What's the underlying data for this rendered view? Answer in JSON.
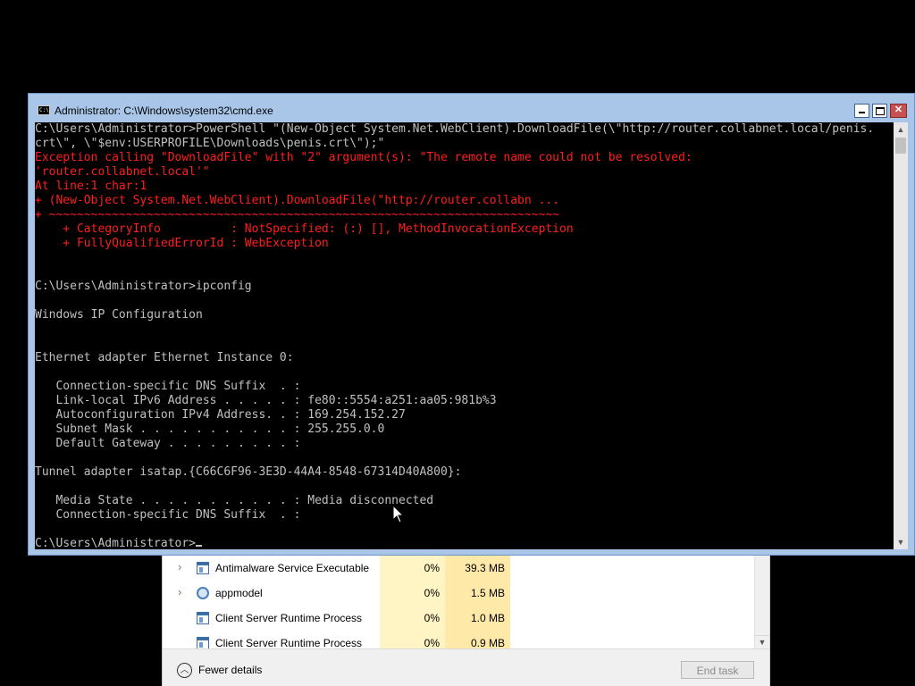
{
  "taskmgr": {
    "processes": [
      {
        "name": "Antimalware Service Executable",
        "cpu": "0%",
        "memory": "39.3 MB",
        "expandable": true,
        "icon": "window-icon"
      },
      {
        "name": "appmodel",
        "cpu": "0%",
        "memory": "1.5 MB",
        "expandable": true,
        "icon": "gear-icon"
      },
      {
        "name": "Client Server Runtime Process",
        "cpu": "0%",
        "memory": "1.0 MB",
        "expandable": false,
        "icon": "window-icon"
      },
      {
        "name": "Client Server Runtime Process",
        "cpu": "0%",
        "memory": "0.9 MB",
        "expandable": false,
        "icon": "window-icon"
      }
    ],
    "fewer_details_label": "Fewer details",
    "end_task_label": "End task"
  },
  "cmd": {
    "title": "Administrator: C:\\Windows\\system32\\cmd.exe",
    "icon_text": "C:\\",
    "colors": {
      "background": "#000000",
      "text": "#c0c0c0",
      "error": "#ff1e1e",
      "titlebar": "#a9c6e8",
      "close": "#c75050"
    },
    "lines": [
      {
        "text": "C:\\Users\\Administrator>PowerShell \"(New-Object System.Net.WebClient).DownloadFile(\\\"http://router.collabnet.local/penis.",
        "err": false
      },
      {
        "text": "crt\\\", \\\"$env:USERPROFILE\\Downloads\\penis.crt\\\");\"",
        "err": false
      },
      {
        "text": "Exception calling \"DownloadFile\" with \"2\" argument(s): \"The remote name could not be resolved:",
        "err": true
      },
      {
        "text": "'router.collabnet.local'\"",
        "err": true
      },
      {
        "text": "At line:1 char:1",
        "err": true
      },
      {
        "text": "+ (New-Object System.Net.WebClient).DownloadFile(\"http://router.collabn ...",
        "err": true
      },
      {
        "text": "+ ~~~~~~~~~~~~~~~~~~~~~~~~~~~~~~~~~~~~~~~~~~~~~~~~~~~~~~~~~~~~~~~~~~~~~~~~~",
        "err": true
      },
      {
        "text": "    + CategoryInfo          : NotSpecified: (:) [], MethodInvocationException",
        "err": true
      },
      {
        "text": "    + FullyQualifiedErrorId : WebException",
        "err": true
      },
      {
        "text": "",
        "err": false
      },
      {
        "text": "",
        "err": false
      },
      {
        "text": "C:\\Users\\Administrator>ipconfig",
        "err": false
      },
      {
        "text": "",
        "err": false
      },
      {
        "text": "Windows IP Configuration",
        "err": false
      },
      {
        "text": "",
        "err": false
      },
      {
        "text": "",
        "err": false
      },
      {
        "text": "Ethernet adapter Ethernet Instance 0:",
        "err": false
      },
      {
        "text": "",
        "err": false
      },
      {
        "text": "   Connection-specific DNS Suffix  . :",
        "err": false
      },
      {
        "text": "   Link-local IPv6 Address . . . . . : fe80::5554:a251:aa05:981b%3",
        "err": false
      },
      {
        "text": "   Autoconfiguration IPv4 Address. . : 169.254.152.27",
        "err": false
      },
      {
        "text": "   Subnet Mask . . . . . . . . . . . : 255.255.0.0",
        "err": false
      },
      {
        "text": "   Default Gateway . . . . . . . . . :",
        "err": false
      },
      {
        "text": "",
        "err": false
      },
      {
        "text": "Tunnel adapter isatap.{C66C6F96-3E3D-44A4-8548-67314D40A800}:",
        "err": false
      },
      {
        "text": "",
        "err": false
      },
      {
        "text": "   Media State . . . . . . . . . . . : Media disconnected",
        "err": false
      },
      {
        "text": "   Connection-specific DNS Suffix  . :",
        "err": false
      },
      {
        "text": "",
        "err": false
      },
      {
        "text": "C:\\Users\\Administrator>",
        "err": false,
        "prompt": true
      }
    ]
  }
}
